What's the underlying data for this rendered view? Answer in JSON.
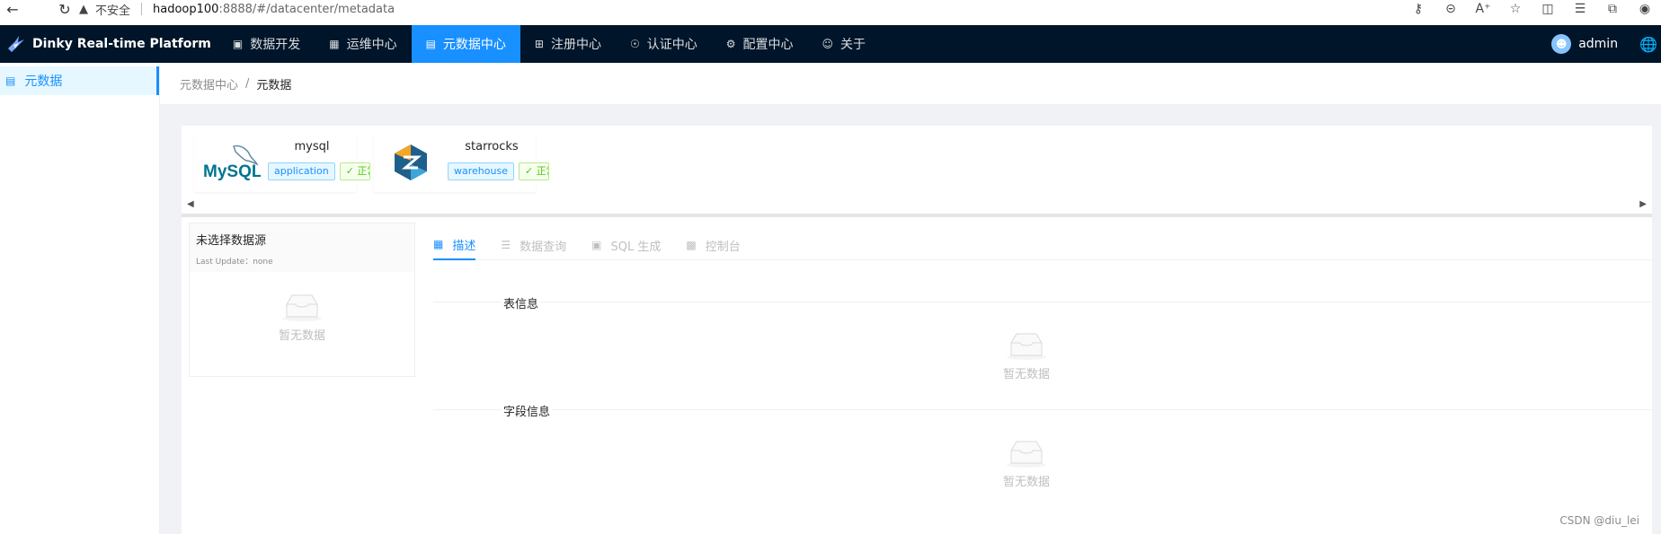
{
  "browser": {
    "security_label": "不安全",
    "url_host": "hadoop100",
    "url_rest": ":8888/#/datacenter/metadata"
  },
  "nav": {
    "brand": "Dinky Real-time Platform",
    "items": [
      {
        "label": "数据开发",
        "icon": "monitor-icon",
        "active": false
      },
      {
        "label": "运维中心",
        "icon": "grid-icon",
        "active": false
      },
      {
        "label": "元数据中心",
        "icon": "database-icon",
        "active": true
      },
      {
        "label": "注册中心",
        "icon": "apps-icon",
        "active": false
      },
      {
        "label": "认证中心",
        "icon": "shield-icon",
        "active": false
      },
      {
        "label": "配置中心",
        "icon": "gear-icon",
        "active": false
      },
      {
        "label": "关于",
        "icon": "smile-icon",
        "active": false
      }
    ],
    "user": "admin"
  },
  "sidebar": {
    "items": [
      {
        "label": "元数据",
        "active": true
      }
    ]
  },
  "breadcrumb": {
    "parent": "元数据中心",
    "separator": "/",
    "current": "元数据"
  },
  "datasources": [
    {
      "name": "mysql",
      "type_tag": "application",
      "status_tag": "正常",
      "logo_text": "MySQL"
    },
    {
      "name": "starrocks",
      "type_tag": "warehouse",
      "status_tag": "正常",
      "logo_text": ""
    }
  ],
  "source_card": {
    "title": "未选择数据源",
    "last_update": "Last Update：none",
    "empty_text": "暂无数据"
  },
  "tabs": [
    {
      "label": "描述",
      "icon": "desc-icon",
      "active": true
    },
    {
      "label": "数据查询",
      "icon": "list-icon",
      "active": false
    },
    {
      "label": "SQL 生成",
      "icon": "code-icon",
      "active": false
    },
    {
      "label": "控制台",
      "icon": "console-icon",
      "active": false
    }
  ],
  "sections": {
    "table_info": "表信息",
    "field_info": "字段信息",
    "empty_text": "暂无数据"
  },
  "watermark": "CSDN @diu_lei",
  "colors": {
    "nav_bg": "#001529",
    "primary": "#1890ff",
    "page_bg": "#f0f2f5"
  }
}
